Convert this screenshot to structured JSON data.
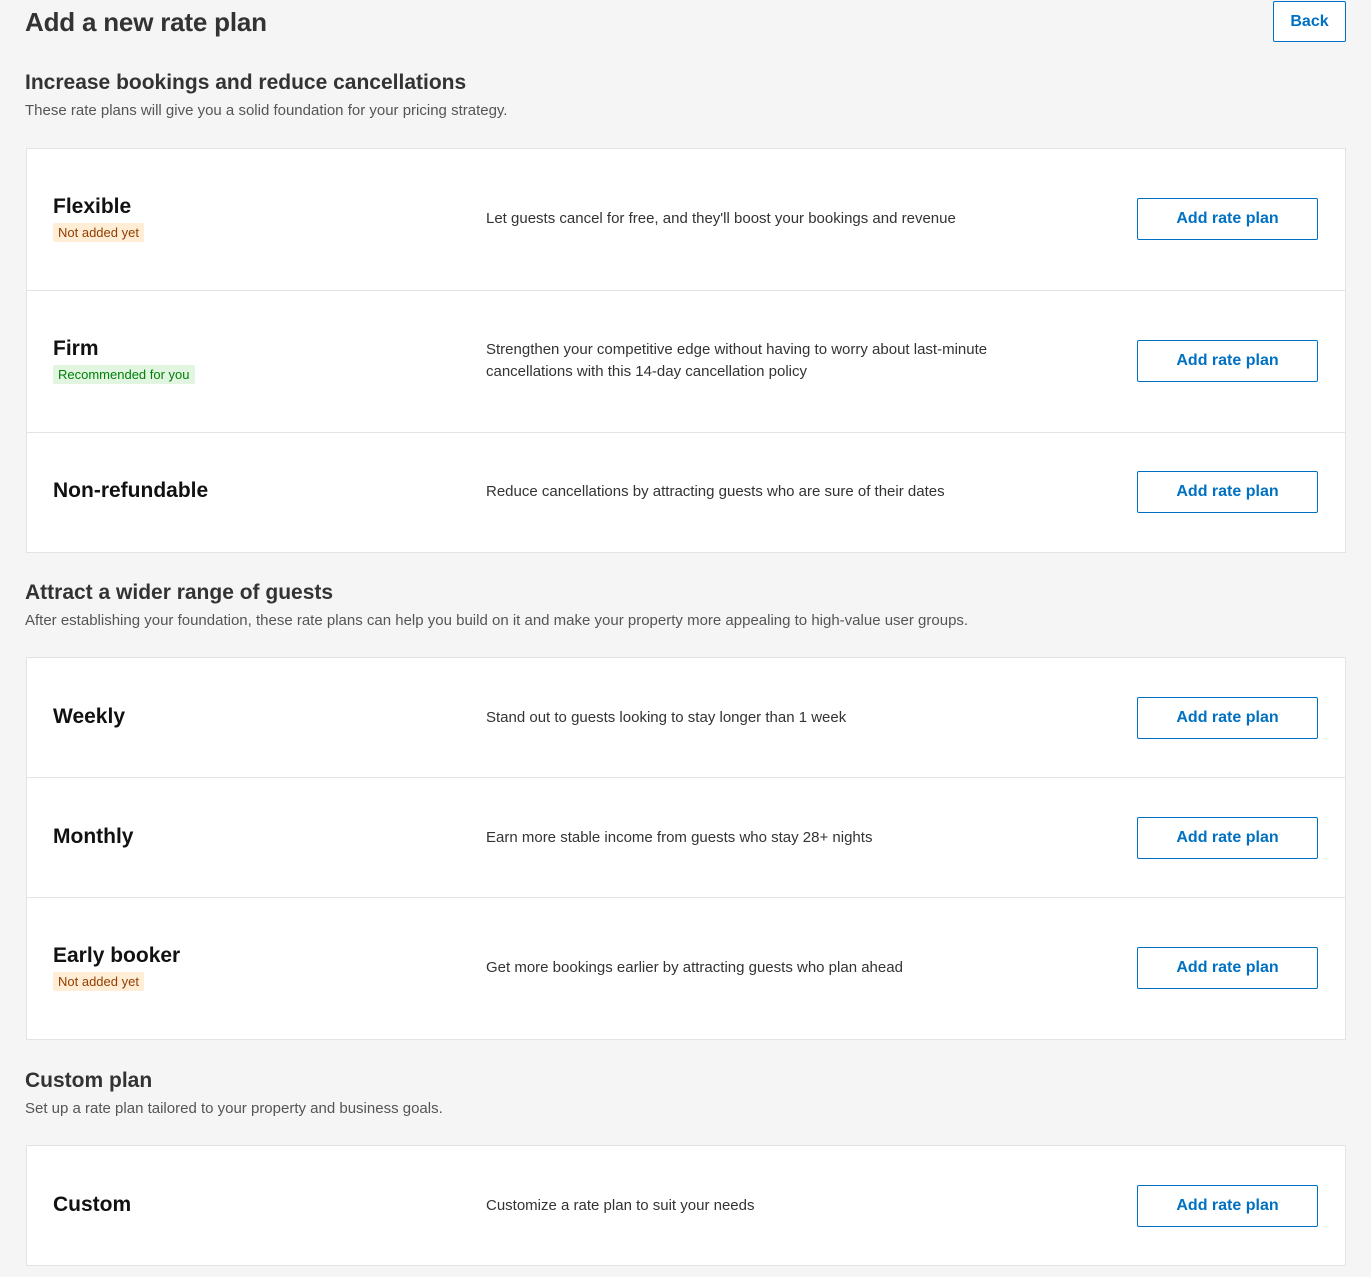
{
  "header": {
    "title": "Add a new rate plan",
    "back_label": "Back"
  },
  "sections": [
    {
      "title": "Increase bookings and reduce cancellations",
      "subtitle": "These rate plans will give you a solid foundation for your pricing strategy.",
      "plans": [
        {
          "name": "Flexible",
          "badge": "Not added yet",
          "description": "Let guests cancel for free, and they'll boost your bookings and revenue",
          "button_label": "Add rate plan"
        },
        {
          "name": "Firm",
          "badge": "Recommended for you",
          "description": "Strengthen your competitive edge without having to worry about last-minute cancellations with this 14-day cancellation policy",
          "button_label": "Add rate plan"
        },
        {
          "name": "Non-refundable",
          "description": "Reduce cancellations by attracting guests who are sure of their dates",
          "button_label": "Add rate plan"
        }
      ]
    },
    {
      "title": "Attract a wider range of guests",
      "subtitle": "After establishing your foundation, these rate plans can help you build on it and make your property more appealing to high-value user groups.",
      "plans": [
        {
          "name": "Weekly",
          "description": "Stand out to guests looking to stay longer than 1 week",
          "button_label": "Add rate plan"
        },
        {
          "name": "Monthly",
          "description": "Earn more stable income from guests who stay 28+ nights",
          "button_label": "Add rate plan"
        },
        {
          "name": "Early booker",
          "badge": "Not added yet",
          "description": "Get more bookings earlier by attracting guests who plan ahead",
          "button_label": "Add rate plan"
        }
      ]
    },
    {
      "title": "Custom plan",
      "subtitle": "Set up a rate plan tailored to your property and business goals.",
      "plans": [
        {
          "name": "Custom",
          "description": "Customize a rate plan to suit your needs",
          "button_label": "Add rate plan"
        }
      ]
    }
  ],
  "colors": {
    "accent": "#0071c2",
    "badge_orange_bg": "#ffedd6",
    "badge_orange_text": "#923e01",
    "badge_green_bg": "#e1f5e1",
    "badge_green_text": "#008009",
    "page_bg": "#f5f5f5"
  }
}
